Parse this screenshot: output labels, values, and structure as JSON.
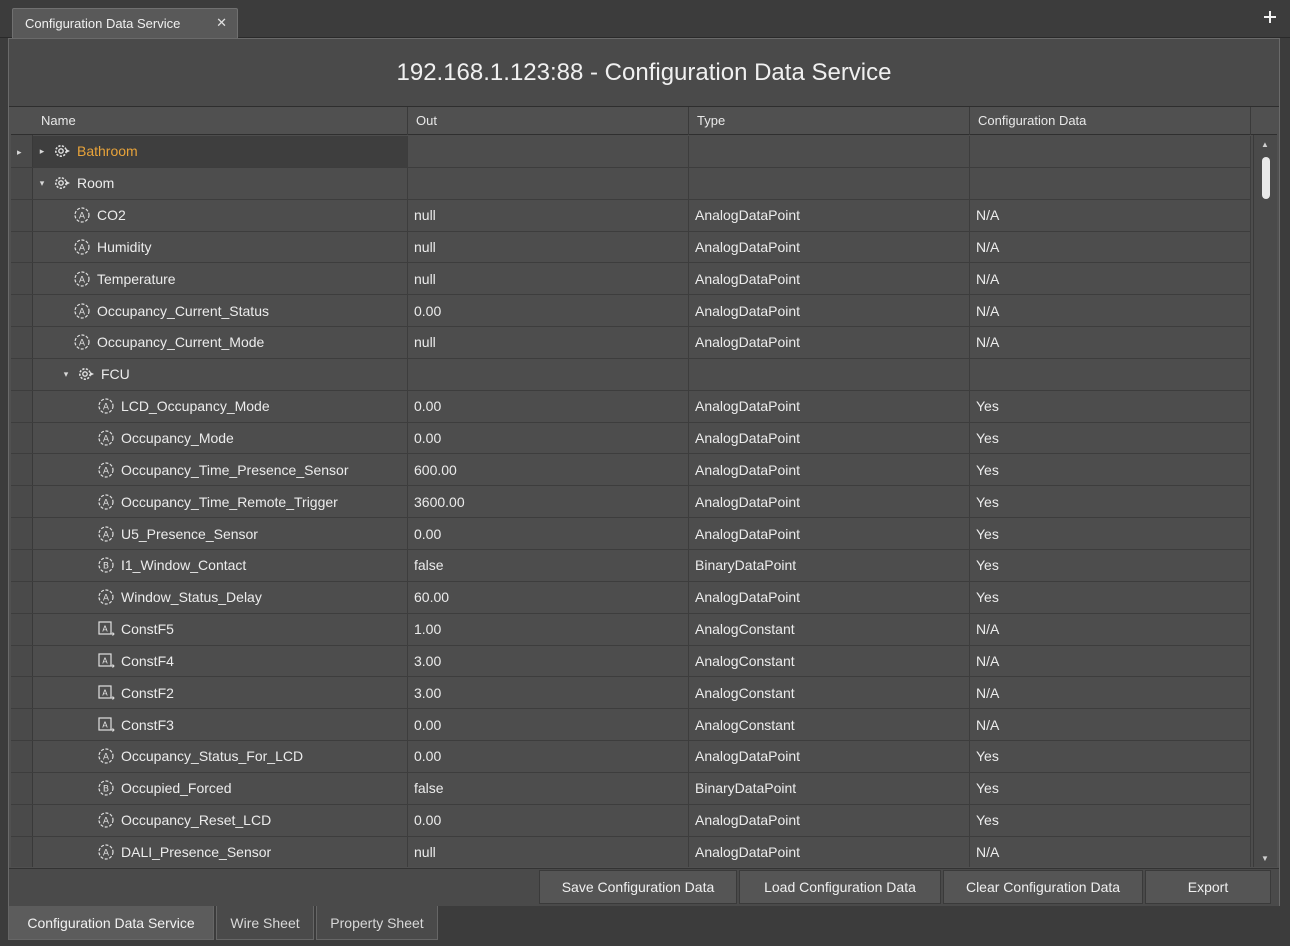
{
  "window_tab": {
    "label": "Configuration Data Service",
    "close": "✕"
  },
  "page_title": "192.168.1.123:88 - Configuration Data Service",
  "columns": [
    "Name",
    "Out",
    "Type",
    "Configuration Data"
  ],
  "rows": [
    {
      "name": "Bathroom",
      "out": "",
      "type": "",
      "cfg": "",
      "icon": "gear-icon",
      "expander": "▸",
      "level": 0
    },
    {
      "name": "Room",
      "out": "",
      "type": "",
      "cfg": "",
      "icon": "gear-icon",
      "expander": "▾",
      "level": 0
    },
    {
      "name": "CO2",
      "out": "null",
      "type": "AnalogDataPoint",
      "cfg": "N/A",
      "icon": "analog-point-icon",
      "level": 1
    },
    {
      "name": "Humidity",
      "out": "null",
      "type": "AnalogDataPoint",
      "cfg": "N/A",
      "icon": "analog-point-icon",
      "level": 1
    },
    {
      "name": "Temperature",
      "out": "null",
      "type": "AnalogDataPoint",
      "cfg": "N/A",
      "icon": "analog-point-icon",
      "level": 1
    },
    {
      "name": "Occupancy_Current_Status",
      "out": "0.00",
      "type": "AnalogDataPoint",
      "cfg": "N/A",
      "icon": "analog-point-icon",
      "level": 1
    },
    {
      "name": "Occupancy_Current_Mode",
      "out": "null",
      "type": "AnalogDataPoint",
      "cfg": "N/A",
      "icon": "analog-point-icon",
      "level": 1
    },
    {
      "name": "FCU",
      "out": "",
      "type": "",
      "cfg": "",
      "icon": "gear-icon",
      "expander": "▾",
      "level": 1
    },
    {
      "name": "LCD_Occupancy_Mode",
      "out": "0.00",
      "type": "AnalogDataPoint",
      "cfg": "Yes",
      "icon": "analog-point-icon",
      "level": 2
    },
    {
      "name": "Occupancy_Mode",
      "out": "0.00",
      "type": "AnalogDataPoint",
      "cfg": "Yes",
      "icon": "analog-point-icon",
      "level": 2
    },
    {
      "name": "Occupancy_Time_Presence_Sensor",
      "out": "600.00",
      "type": "AnalogDataPoint",
      "cfg": "Yes",
      "icon": "analog-point-icon",
      "level": 2
    },
    {
      "name": "Occupancy_Time_Remote_Trigger",
      "out": "3600.00",
      "type": "AnalogDataPoint",
      "cfg": "Yes",
      "icon": "analog-point-icon",
      "level": 2
    },
    {
      "name": "U5_Presence_Sensor",
      "out": "0.00",
      "type": "AnalogDataPoint",
      "cfg": "Yes",
      "icon": "analog-point-icon",
      "level": 2
    },
    {
      "name": "I1_Window_Contact",
      "out": "false",
      "type": "BinaryDataPoint",
      "cfg": "Yes",
      "icon": "binary-point-icon",
      "level": 2
    },
    {
      "name": "Window_Status_Delay",
      "out": "60.00",
      "type": "AnalogDataPoint",
      "cfg": "Yes",
      "icon": "analog-point-icon",
      "level": 2
    },
    {
      "name": "ConstF5",
      "out": "1.00",
      "type": "AnalogConstant",
      "cfg": "N/A",
      "icon": "analog-constant-icon",
      "level": 2
    },
    {
      "name": "ConstF4",
      "out": "3.00",
      "type": "AnalogConstant",
      "cfg": "N/A",
      "icon": "analog-constant-icon",
      "level": 2
    },
    {
      "name": "ConstF2",
      "out": "3.00",
      "type": "AnalogConstant",
      "cfg": "N/A",
      "icon": "analog-constant-icon",
      "level": 2
    },
    {
      "name": "ConstF3",
      "out": "0.00",
      "type": "AnalogConstant",
      "cfg": "N/A",
      "icon": "analog-constant-icon",
      "level": 2
    },
    {
      "name": "Occupancy_Status_For_LCD",
      "out": "0.00",
      "type": "AnalogDataPoint",
      "cfg": "Yes",
      "icon": "analog-point-icon",
      "level": 2
    },
    {
      "name": "Occupied_Forced",
      "out": "false",
      "type": "BinaryDataPoint",
      "cfg": "Yes",
      "icon": "binary-point-icon",
      "level": 2
    },
    {
      "name": "Occupancy_Reset_LCD",
      "out": "0.00",
      "type": "AnalogDataPoint",
      "cfg": "Yes",
      "icon": "analog-point-icon",
      "level": 2
    },
    {
      "name": "DALI_Presence_Sensor",
      "out": "null",
      "type": "AnalogDataPoint",
      "cfg": "N/A",
      "icon": "analog-point-icon",
      "level": 2
    }
  ],
  "buttons": {
    "save": "Save Configuration Data",
    "load": "Load Configuration Data",
    "clear": "Clear Configuration Data",
    "export": "Export"
  },
  "bottom_tabs": [
    "Configuration Data Service",
    "Wire Sheet",
    "Property Sheet"
  ],
  "colors": {
    "accent_label": "#e8a33a",
    "background": "#3c3c3c",
    "panel": "#505050"
  }
}
